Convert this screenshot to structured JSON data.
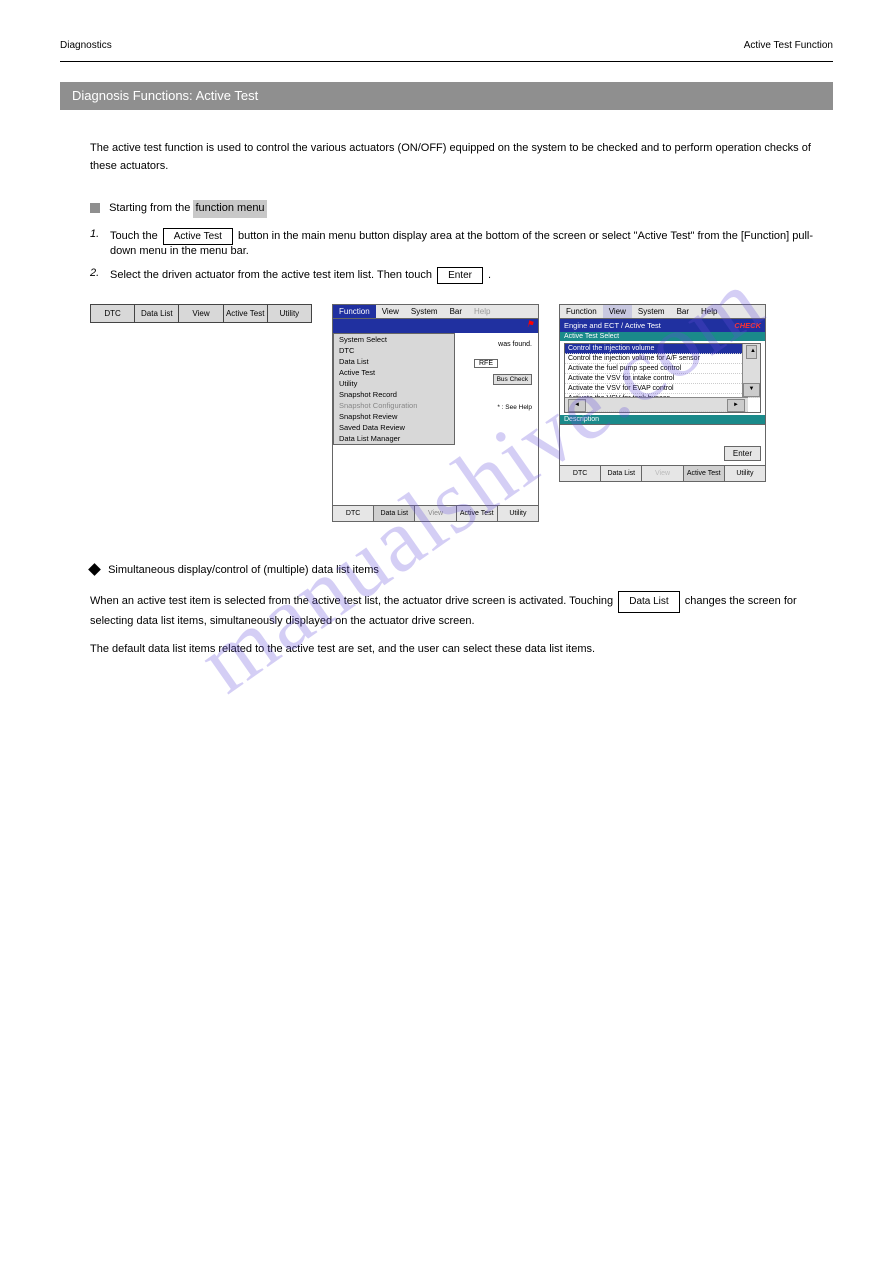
{
  "header": {
    "left": "Diagnostics",
    "right": "Active Test Function"
  },
  "section_bar": "Diagnosis Functions: Active Test",
  "intro": "The active test function is used to control the various actuators (ON/OFF) equipped on the system to be checked and to perform operation checks of these actuators.",
  "subheading_label": "Starting from the",
  "subheading_highlight": "function menu",
  "step1_prefix": "Touch the",
  "step1_btn": "Active Test",
  "step1_suffix": "button in the main menu button display area at the bottom of the screen or select \"Active Test\" from the [Function] pull-down menu in the menu bar.",
  "step2_prefix": "Select the driven actuator from the active test item list. Then touch",
  "step2_btn": "Enter",
  "step2_suffix": ".",
  "mini_toolbar": [
    "DTC",
    "Data List",
    "View",
    "Active Test",
    "Utility"
  ],
  "dropdown_menu": {
    "menubar": [
      "Function",
      "View",
      "System",
      "Bar",
      "Help"
    ],
    "items": [
      "System Select",
      "DTC",
      "Data List",
      "Active Test",
      "Utility",
      "Snapshot Record",
      "Snapshot Configuration",
      "Snapshot Review",
      "Saved Data Review",
      "Data List Manager"
    ],
    "disabled_index": 6,
    "found_text": "was found.",
    "rfe": "RFE",
    "bus_check": "Bus Check",
    "see_help": "* : See Help",
    "bottom": [
      "DTC",
      "Data List",
      "View",
      "Active Test",
      "Utility"
    ]
  },
  "shot3": {
    "menubar": [
      "Function",
      "View",
      "System",
      "Bar",
      "Help"
    ],
    "title_left": "Engine and ECT / Active Test",
    "title_right": "CHECK",
    "sub": "Active Test Select",
    "items": [
      "Control the injection volume",
      "Control the injection volume for A/F sensor",
      "Activate the fuel pump speed control",
      "Activate the VSV for intake control",
      "Activate the VSV for EVAP control",
      "Activate the VSV for tank bypass"
    ],
    "desc_label": "Description",
    "enter": "Enter",
    "bottom": [
      "DTC",
      "Data List",
      "View",
      "Active Test",
      "Utility"
    ]
  },
  "diamond_heading": "Simultaneous display/control of (multiple) data list items",
  "diamond_p1_prefix": "When an active test item is selected from the active test list, the actuator drive screen is activated. Touching",
  "diamond_btn": "Data List",
  "diamond_p1_suffix": "changes the screen for selecting data list items, simultaneously displayed on the actuator drive screen.",
  "diamond_p2": "The default data list items related to the active test are set, and the user can select these data list items.",
  "watermark": "manualshive.com"
}
